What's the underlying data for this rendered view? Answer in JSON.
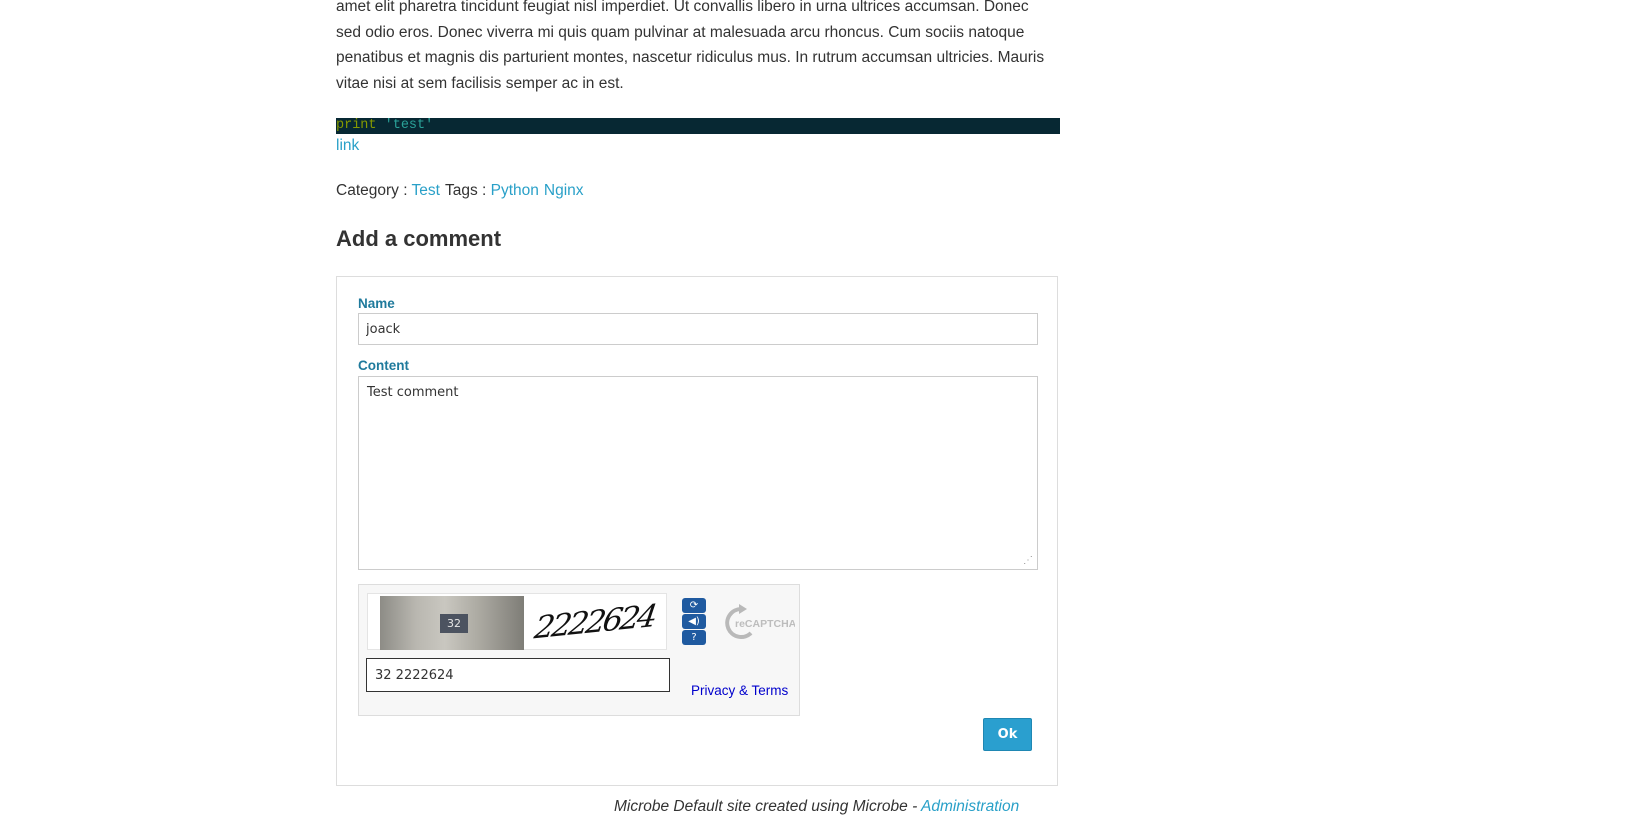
{
  "article": {
    "paragraph_lines": [
      "amet elit pharetra tincidunt feugiat nisl imperdiet. Ut convallis libero in urna ultrices accumsan. Donec",
      "sed odio eros. Donec viverra mi quis quam pulvinar at malesuada arcu rhoncus. Cum sociis natoque",
      "penatibus et magnis dis parturient montes, nascetur ridiculus mus. In rutrum accumsan ultricies. Mauris",
      "vitae nisi at sem facilisis semper ac in est."
    ],
    "code": {
      "keyword": "print",
      "string": "'test'"
    },
    "link_text": "link",
    "category_label": "Category :",
    "category": "Test",
    "tags_label": "Tags :",
    "tags": [
      "Python",
      "Nginx"
    ]
  },
  "comment_form": {
    "heading": "Add a comment",
    "name_label": "Name",
    "name_value": "joack",
    "content_label": "Content",
    "content_value": "Test comment",
    "submit_label": "Ok"
  },
  "captcha": {
    "plate_text": "32",
    "challenge_word": "2222624",
    "response_value": "32 2222624",
    "privacy_link": "Privacy & Terms",
    "logo_text": "reCAPTCHA™",
    "button_icons": [
      "refresh-icon",
      "audio-icon",
      "help-icon"
    ]
  },
  "footer": {
    "text": "Microbe Default site created using Microbe - ",
    "admin_link": "Administration"
  },
  "colors": {
    "link": "#29a0c8",
    "label": "#1f7a9c",
    "code_bg": "#072833",
    "button": "#2a9fcf"
  }
}
